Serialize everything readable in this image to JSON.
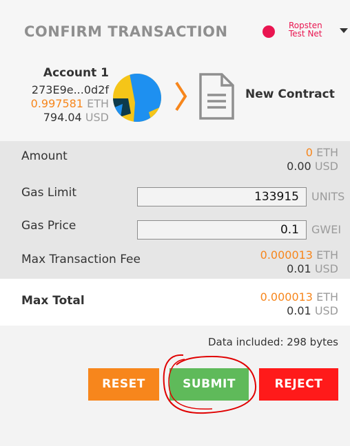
{
  "header": {
    "title": "CONFIRM TRANSACTION",
    "network_line1": "Ropsten",
    "network_line2": "Test Net",
    "network_color": "#e91550"
  },
  "account": {
    "name": "Account 1",
    "address": "273E9e...0d2f",
    "eth_balance": "0.997581",
    "eth_unit": "ETH",
    "usd_balance": "794.04",
    "usd_unit": "USD"
  },
  "recipient": {
    "label": "New Contract",
    "icon": "document-icon"
  },
  "details": {
    "amount": {
      "label": "Amount",
      "eth": "0",
      "eth_unit": "ETH",
      "usd": "0.00",
      "usd_unit": "USD"
    },
    "gas_limit": {
      "label": "Gas Limit",
      "value": "133915",
      "unit": "UNITS"
    },
    "gas_price": {
      "label": "Gas Price",
      "value": "0.1",
      "unit": "GWEI"
    },
    "max_fee": {
      "label": "Max Transaction Fee",
      "eth": "0.000013",
      "eth_unit": "ETH",
      "usd": "0.01",
      "usd_unit": "USD"
    }
  },
  "total": {
    "label": "Max Total",
    "eth": "0.000013",
    "eth_unit": "ETH",
    "usd": "0.01",
    "usd_unit": "USD"
  },
  "data_included": "Data included: 298 bytes",
  "buttons": {
    "reset": "RESET",
    "submit": "SUBMIT",
    "reject": "REJECT"
  },
  "colors": {
    "accent_orange": "#f7861c",
    "submit_green": "#5fba5a",
    "reject_red": "#ff1a1a",
    "annotation_red": "#e00000"
  }
}
